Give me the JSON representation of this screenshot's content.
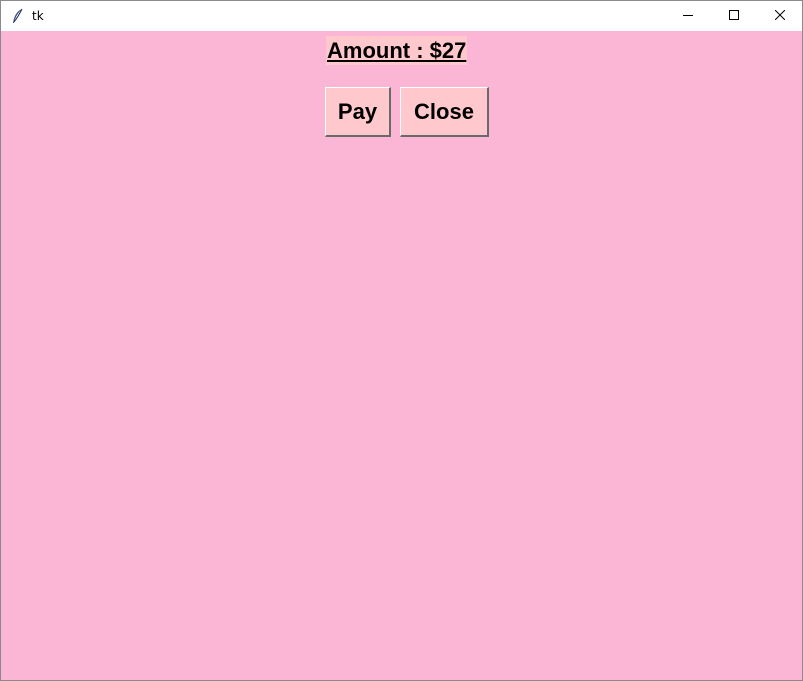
{
  "window": {
    "title": "tk",
    "icons": {
      "app": "feather-icon",
      "minimize": "minimize-icon",
      "maximize": "maximize-icon",
      "close": "close-icon"
    }
  },
  "colors": {
    "background": "#fbb6d6",
    "widget_background": "#ffc8cc",
    "text": "#000000"
  },
  "main": {
    "amount_label": "Amount : $27",
    "pay_button": "Pay",
    "close_button": "Close"
  }
}
